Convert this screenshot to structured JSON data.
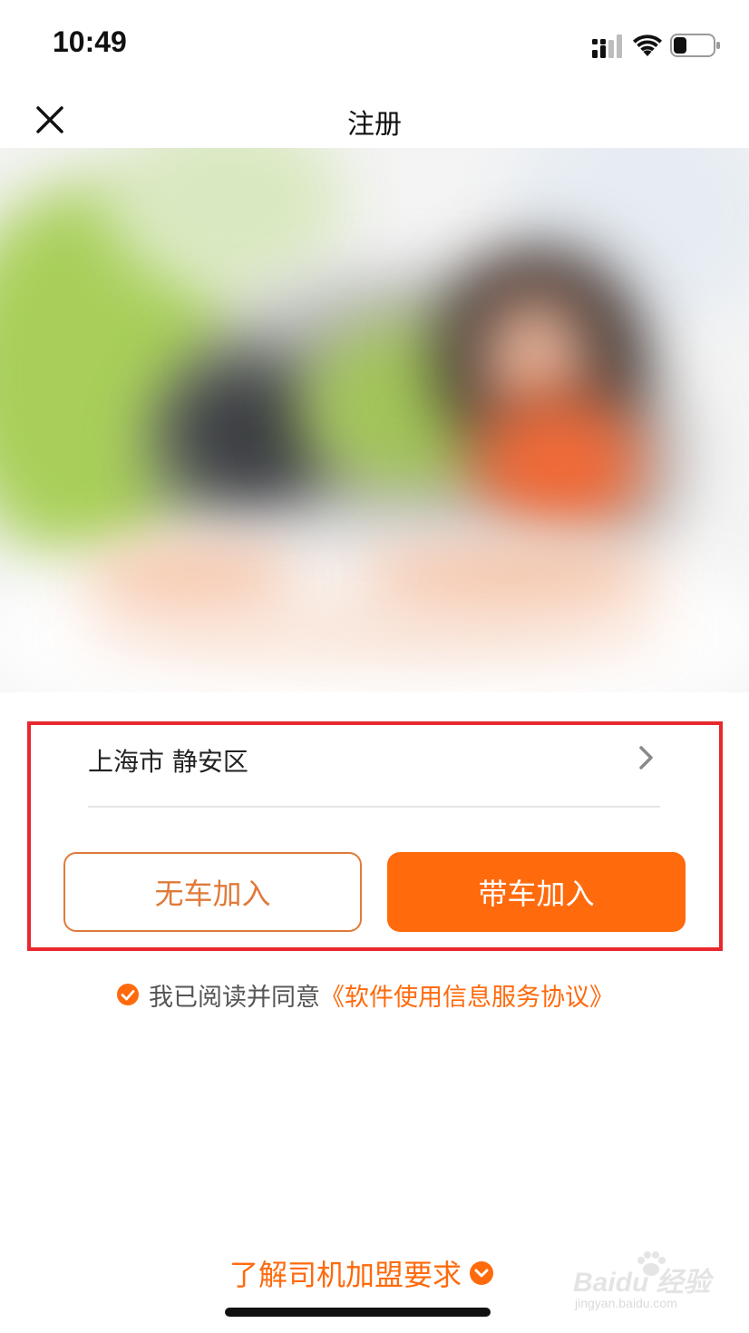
{
  "status_bar": {
    "time": "10:49",
    "icons": [
      "signal-icon",
      "wifi-icon",
      "battery-icon"
    ]
  },
  "nav": {
    "title": "注册",
    "close_icon": "close-icon"
  },
  "form": {
    "location": "上海市 静安区",
    "location_icon": "chevron-right-icon",
    "join_without_car": "无车加入",
    "join_with_car": "带车加入"
  },
  "agreement": {
    "prefix": "我已阅读并同意",
    "link": "《软件使用信息服务协议》",
    "checked": true
  },
  "footer": {
    "requirements_link": "了解司机加盟要求"
  },
  "watermark": {
    "brand": "Baidu 经验",
    "url": "jingyan.baidu.com"
  },
  "colors": {
    "accent": "#ff6a0d",
    "outline_button": "#e07a3a",
    "highlight_frame": "#e8282d"
  }
}
